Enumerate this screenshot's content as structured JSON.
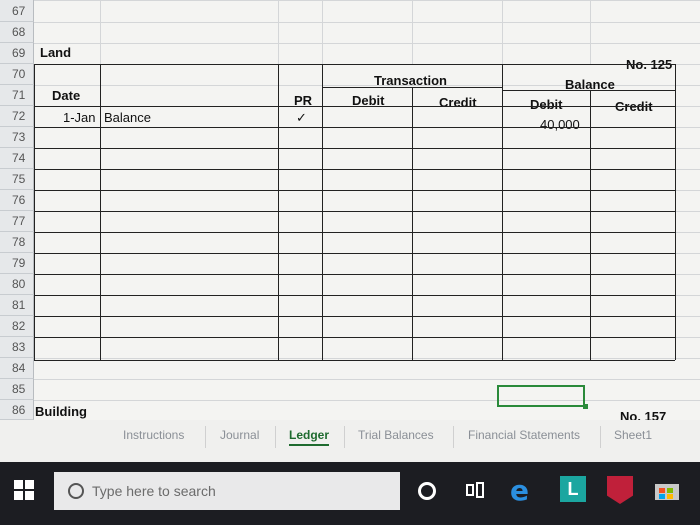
{
  "row_numbers": [
    "67",
    "68",
    "69",
    "70",
    "71",
    "72",
    "73",
    "74",
    "75",
    "76",
    "77",
    "78",
    "79",
    "80",
    "81",
    "82",
    "83",
    "84",
    "85",
    "86"
  ],
  "land": {
    "title": "Land",
    "account_no": "No. 125",
    "headers": {
      "transaction": "Transaction",
      "balance": "Balance",
      "date": "Date",
      "pr": "PR",
      "debit": "Debit",
      "credit": "Credit",
      "bal_debit": "Debit",
      "bal_credit": "Credit"
    },
    "entry": {
      "date": "1-Jan",
      "description": "Balance",
      "pr": "✓",
      "balance_debit": "40,000"
    }
  },
  "building": {
    "title": "Building",
    "account_no": "No. 157"
  },
  "sheet_tabs": [
    "Instructions",
    "Journal",
    "Ledger",
    "Trial Balances",
    "Financial Statements",
    "Sheet1"
  ],
  "active_tab": "Ledger",
  "taskbar": {
    "search_placeholder": "Type here to search",
    "icons": [
      "windows-icon",
      "search-icon",
      "cortana-icon",
      "task-view-icon",
      "edge-icon",
      "app-l-icon",
      "mcafee-icon",
      "store-icon"
    ]
  }
}
